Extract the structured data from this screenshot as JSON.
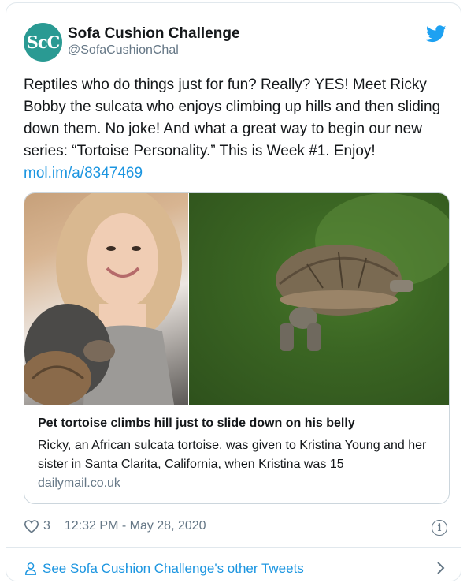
{
  "author": {
    "avatar_text": "ScC",
    "display_name": "Sofa Cushion Challenge",
    "handle": "@SofaCushionChal",
    "avatar_color": "#2a9a93"
  },
  "tweet": {
    "text": "Reptiles who do things just for fun?  Really?  YES!  Meet Ricky Bobby the sulcata who enjoys climbing up hills and then sliding down them.  No joke!  And what a great way to begin our new series: “Tortoise Personality.”  This is Week #1.  Enjoy! ",
    "link": "mol.im/a/8347469"
  },
  "link_card": {
    "title": "Pet tortoise climbs hill just to slide down on his belly",
    "description": "Ricky, an African sulcata tortoise, was given to Kristina Young and her sister in Santa Clarita, California, when Kristina was 15",
    "domain": "dailymail.co.uk"
  },
  "meta": {
    "likes": "3",
    "timestamp": "12:32 PM - May 28, 2020"
  },
  "footer": {
    "other_tweets_label": "See Sofa Cushion Challenge's other Tweets"
  },
  "colors": {
    "link": "#1b95e0",
    "secondary_text": "#657786",
    "border": "#e1e8ed"
  },
  "icons": [
    "twitter-bird-icon",
    "heart-icon",
    "info-icon",
    "person-icon",
    "chevron-right-icon"
  ]
}
